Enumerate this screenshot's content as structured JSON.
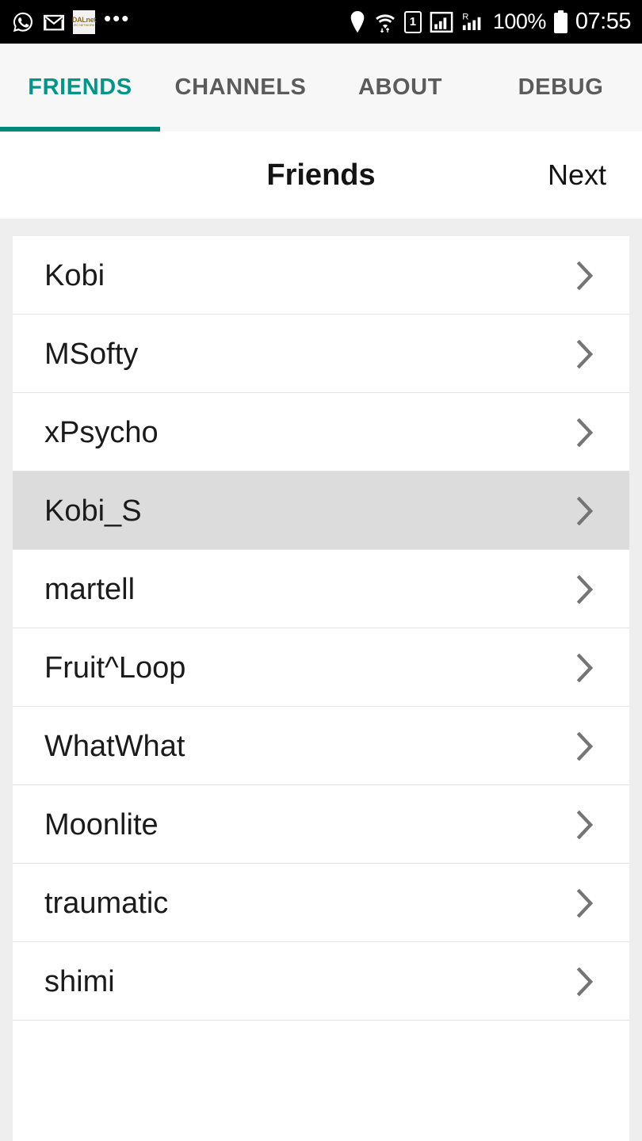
{
  "status_bar": {
    "notifications": [
      {
        "icon": "whatsapp-icon",
        "label": "WhatsApp"
      },
      {
        "icon": "gmail-icon",
        "label": "Gmail"
      },
      {
        "icon": "news-icon",
        "label": "DALnet",
        "line1": "DALnet",
        "line2": "IRC NETWORK"
      },
      {
        "icon": "overflow-dots-icon",
        "label": "..."
      }
    ],
    "overflow_dots": "•••",
    "location_icon": "location-pin-icon",
    "wifi_icon": "wifi-icon",
    "sim_label": "1",
    "signal_icon": "signal-bars-icon",
    "roaming_label": "R",
    "roaming_icon": "roaming-signal-icon",
    "battery_percent": "100%",
    "battery_icon": "battery-full-icon",
    "time": "07:55"
  },
  "tabs": {
    "items": [
      {
        "label": "FRIENDS",
        "active": true
      },
      {
        "label": "CHANNELS",
        "active": false
      },
      {
        "label": "ABOUT",
        "active": false
      },
      {
        "label": "DEBUG",
        "active": false
      }
    ],
    "active_color": "#009688",
    "inactive_color": "#5b5b5b",
    "underline_color": "#00897b"
  },
  "header": {
    "title": "Friends",
    "action_label": "Next"
  },
  "friends_list": {
    "selected_index": 3,
    "rows": [
      {
        "name": "Kobi",
        "chevron": "chevron-right-icon"
      },
      {
        "name": "MSofty",
        "chevron": "chevron-right-icon"
      },
      {
        "name": "xPsycho",
        "chevron": "chevron-right-icon"
      },
      {
        "name": "Kobi_S",
        "chevron": "chevron-right-icon"
      },
      {
        "name": "martell",
        "chevron": "chevron-right-icon"
      },
      {
        "name": "Fruit^Loop",
        "chevron": "chevron-right-icon"
      },
      {
        "name": "WhatWhat",
        "chevron": "chevron-right-icon"
      },
      {
        "name": "Moonlite",
        "chevron": "chevron-right-icon"
      },
      {
        "name": "traumatic",
        "chevron": "chevron-right-icon"
      },
      {
        "name": "shimi",
        "chevron": "chevron-right-icon"
      }
    ],
    "selected_background": "#dcdcdc",
    "row_background": "#ffffff",
    "divider_color": "#e4e4e4",
    "page_background": "#eeeeee"
  }
}
